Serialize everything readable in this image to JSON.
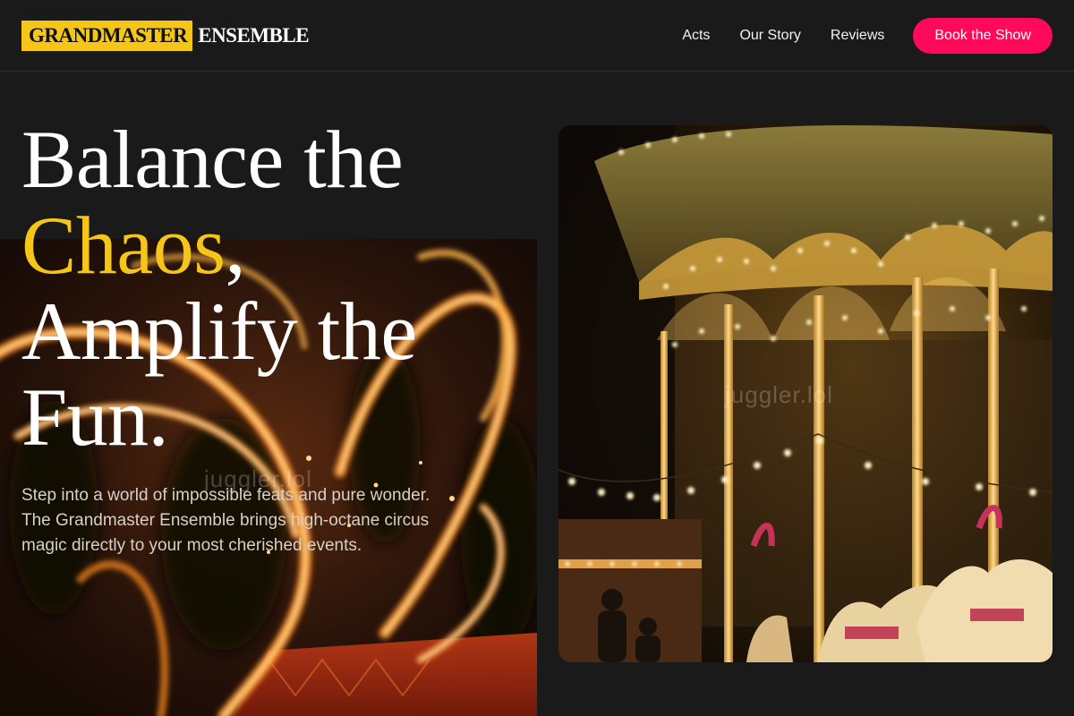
{
  "brand": {
    "logo_mark": "GRANDMASTER",
    "logo_text": "ENSEMBLE"
  },
  "nav": {
    "links": [
      "Acts",
      "Our Story",
      "Reviews"
    ],
    "cta_label": "Book the Show"
  },
  "hero": {
    "title_line1": "Balance the",
    "title_accent": "Chaos",
    "title_comma": ",",
    "title_line3": "Amplify the",
    "title_line4": "Fun.",
    "subtitle": "Step into a world of impossible feats and pure wonder. The Grandmaster Ensemble brings high-octane circus magic directly to your most cherished events."
  },
  "images": {
    "left_alt": "fire-spinning-performer-photo",
    "right_alt": "illuminated-carousel-photo"
  },
  "watermarks": [
    "juggler.lol",
    "juggler.lol"
  ],
  "colors": {
    "background": "#1a1a1a",
    "accent_yellow": "#f5c518",
    "cta_pink": "#ff0a5a",
    "text": "#ffffff"
  }
}
